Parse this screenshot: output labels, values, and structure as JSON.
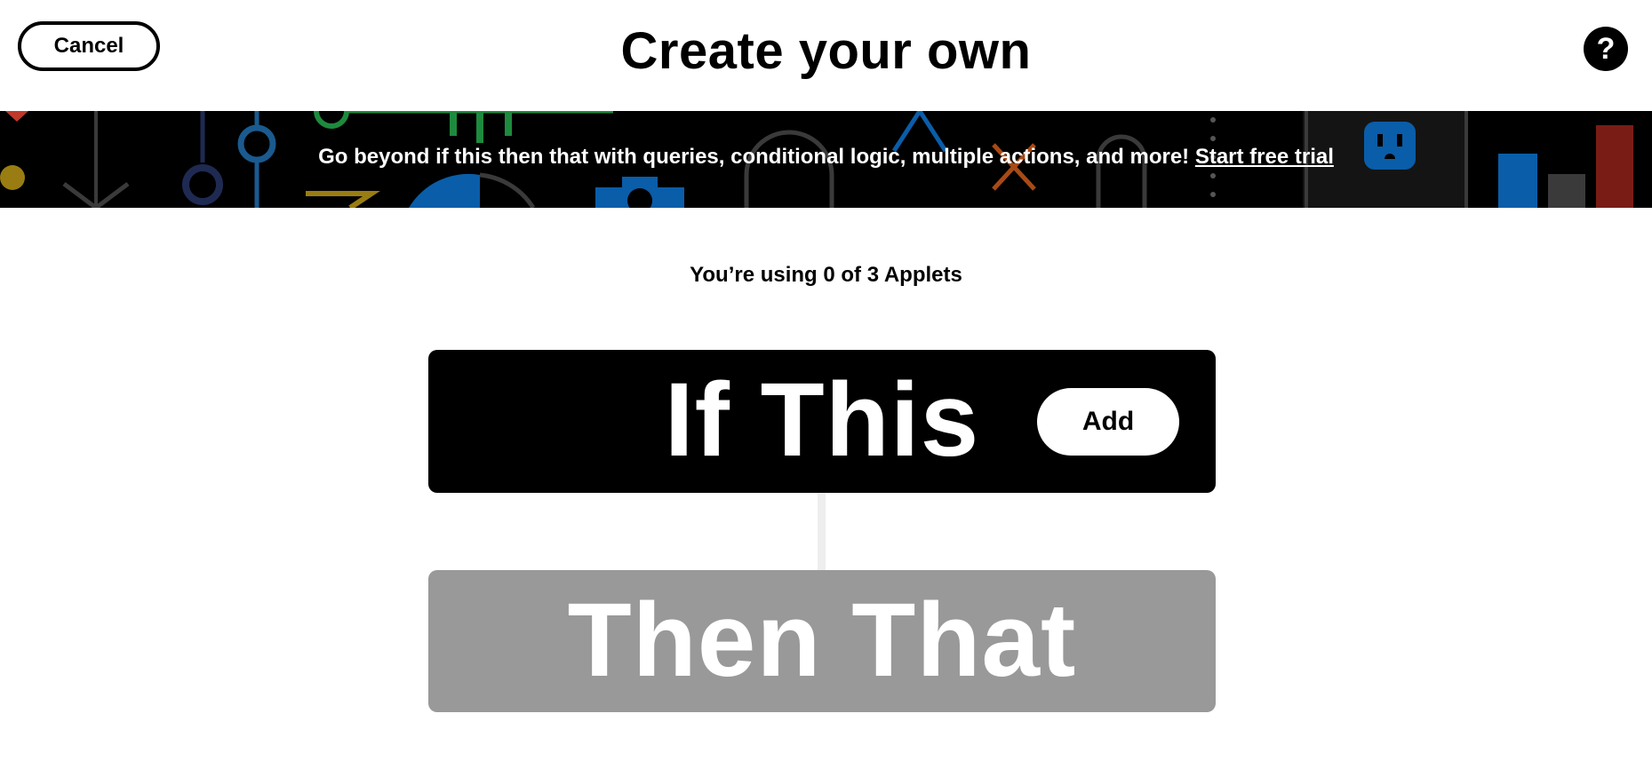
{
  "header": {
    "cancel_label": "Cancel",
    "title": "Create your own",
    "help_label": "?"
  },
  "banner": {
    "text": "Go beyond if this then that with queries, conditional logic, multiple actions, and more!",
    "link_label": "Start free trial"
  },
  "usage": {
    "text": "You’re using 0 of 3 Applets"
  },
  "builder": {
    "trigger_label": "If This",
    "add_label": "Add",
    "action_label": "Then That"
  },
  "colors": {
    "background": "#ffffff",
    "primary": "#000000",
    "disabled_block": "#999999",
    "connector": "#eeeeee",
    "banner_text": "#ffffff"
  }
}
